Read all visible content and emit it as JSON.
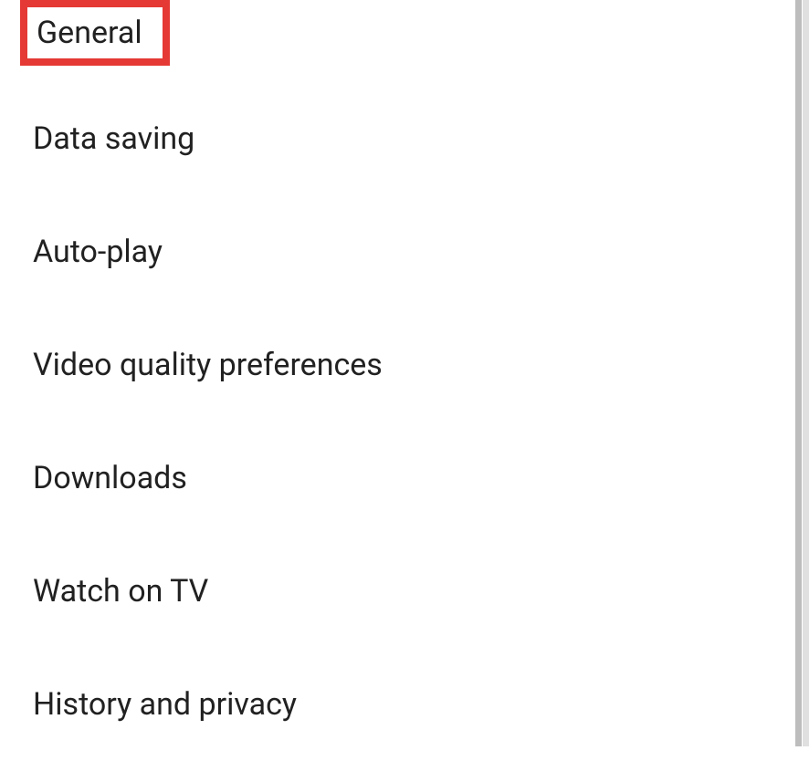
{
  "settings": {
    "items": [
      {
        "label": "General",
        "highlighted": true
      },
      {
        "label": "Data saving",
        "highlighted": false
      },
      {
        "label": "Auto-play",
        "highlighted": false
      },
      {
        "label": "Video quality preferences",
        "highlighted": false
      },
      {
        "label": "Downloads",
        "highlighted": false
      },
      {
        "label": "Watch on TV",
        "highlighted": false
      },
      {
        "label": "History and privacy",
        "highlighted": false
      }
    ]
  },
  "colors": {
    "highlight_border": "#e53935",
    "text": "#212121",
    "scrollbar": "#bdbdbd"
  }
}
